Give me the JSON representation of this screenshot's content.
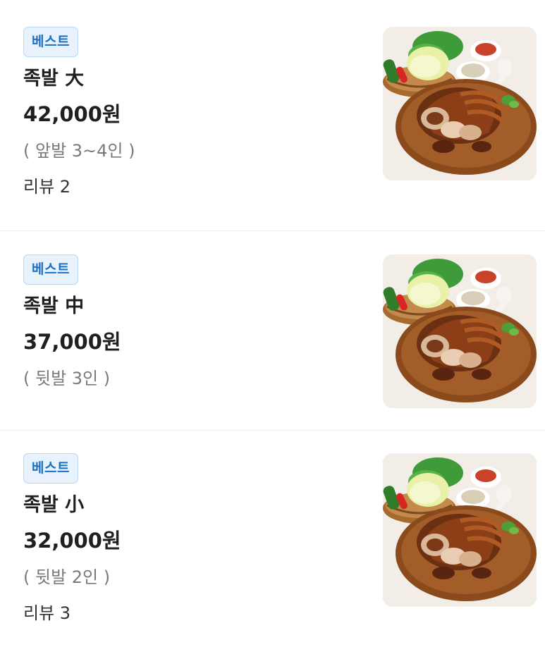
{
  "menu": {
    "items": [
      {
        "badge": "베스트",
        "name": "족발 大",
        "price": "42,000원",
        "description": "( 앞발 3~4인 )",
        "review": "리뷰 2",
        "image_icon": "jokbal-photo"
      },
      {
        "badge": "베스트",
        "name": "족발 中",
        "price": "37,000원",
        "description": "( 뒷발 3인 )",
        "review": "",
        "image_icon": "jokbal-photo"
      },
      {
        "badge": "베스트",
        "name": "족발 小",
        "price": "32,000원",
        "description": "( 뒷발 2인 )",
        "review": "리뷰 3",
        "image_icon": "jokbal-photo"
      }
    ]
  },
  "colors": {
    "badge_text": "#1d6fbf",
    "badge_bg": "#e8f2fd",
    "badge_border": "#b9d6f5",
    "divider": "#ececec"
  }
}
